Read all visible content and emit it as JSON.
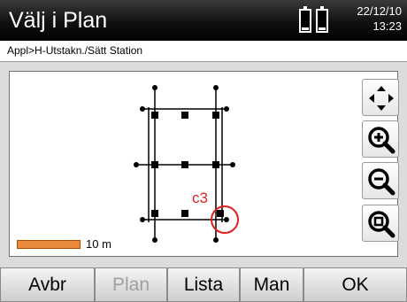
{
  "header": {
    "title": "Välj i Plan",
    "date": "22/12/10",
    "time": "13:23",
    "battery_icons": [
      "battery-icon",
      "battery-icon"
    ]
  },
  "breadcrumb": "Appl>H-Utstakn./Sätt Station",
  "plan": {
    "point_label": "c3",
    "scale_label": "10 m",
    "highlight_color": "#e02020",
    "scale_bar_color": "#e98a3a"
  },
  "tools": [
    "pan-icon",
    "zoom-in-icon",
    "zoom-out-icon",
    "zoom-fit-icon"
  ],
  "softkeys": {
    "cancel": "Avbr",
    "plan": "Plan",
    "list": "Lista",
    "manual": "Man",
    "ok": "OK"
  }
}
